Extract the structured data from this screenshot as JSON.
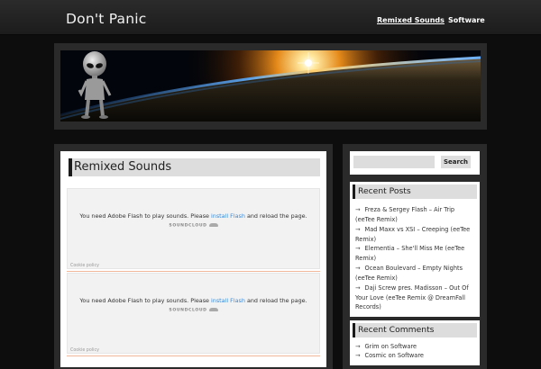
{
  "header": {
    "site_title": "Don't Panic"
  },
  "nav": [
    {
      "label": "Remixed Sounds",
      "active": true
    },
    {
      "label": "Software",
      "active": false
    }
  ],
  "page": {
    "title": "Remixed Sounds",
    "embeds": [
      {
        "msg_before": "You need Adobe Flash to play sounds. Please ",
        "link": "install Flash",
        "msg_after": " and reload the page.",
        "brand": "SOUNDCLOUD",
        "cookie": "Cookie policy"
      },
      {
        "msg_before": "You need Adobe Flash to play sounds. Please ",
        "link": "install Flash",
        "msg_after": " and reload the page.",
        "brand": "SOUNDCLOUD",
        "cookie": "Cookie policy"
      }
    ]
  },
  "sidebar": {
    "search": {
      "placeholder": "",
      "button": "Search"
    },
    "recent_posts": {
      "title": "Recent Posts",
      "items": [
        "Freza & Sergey Flash – Air Trip (eeTee Remix)",
        "Mad Maxx vs XSI – Creeping (eeTee Remix)",
        "Elementia – She'll Miss Me (eeTee Remix)",
        "Ocean Boulevard – Empty Nights (eeTee Remix)",
        "Daji Screw pres. Madisson – Out Of Your Love (eeTee Remix @ DreamFall Records)"
      ]
    },
    "recent_comments": {
      "title": "Recent Comments",
      "items": [
        {
          "author": "Grim",
          "on": " on ",
          "post": "Software"
        },
        {
          "author": "Cosmic",
          "on": " on ",
          "post": "Software"
        }
      ]
    }
  },
  "icons": {
    "list_arrow": "arrow-right-icon",
    "soundcloud": "soundcloud-cloud-icon"
  },
  "colors": {
    "link": "#3d8ad6",
    "background": "#0d0d0d",
    "panel": "#2a2a2a",
    "accent_separator": "#f0b899"
  }
}
